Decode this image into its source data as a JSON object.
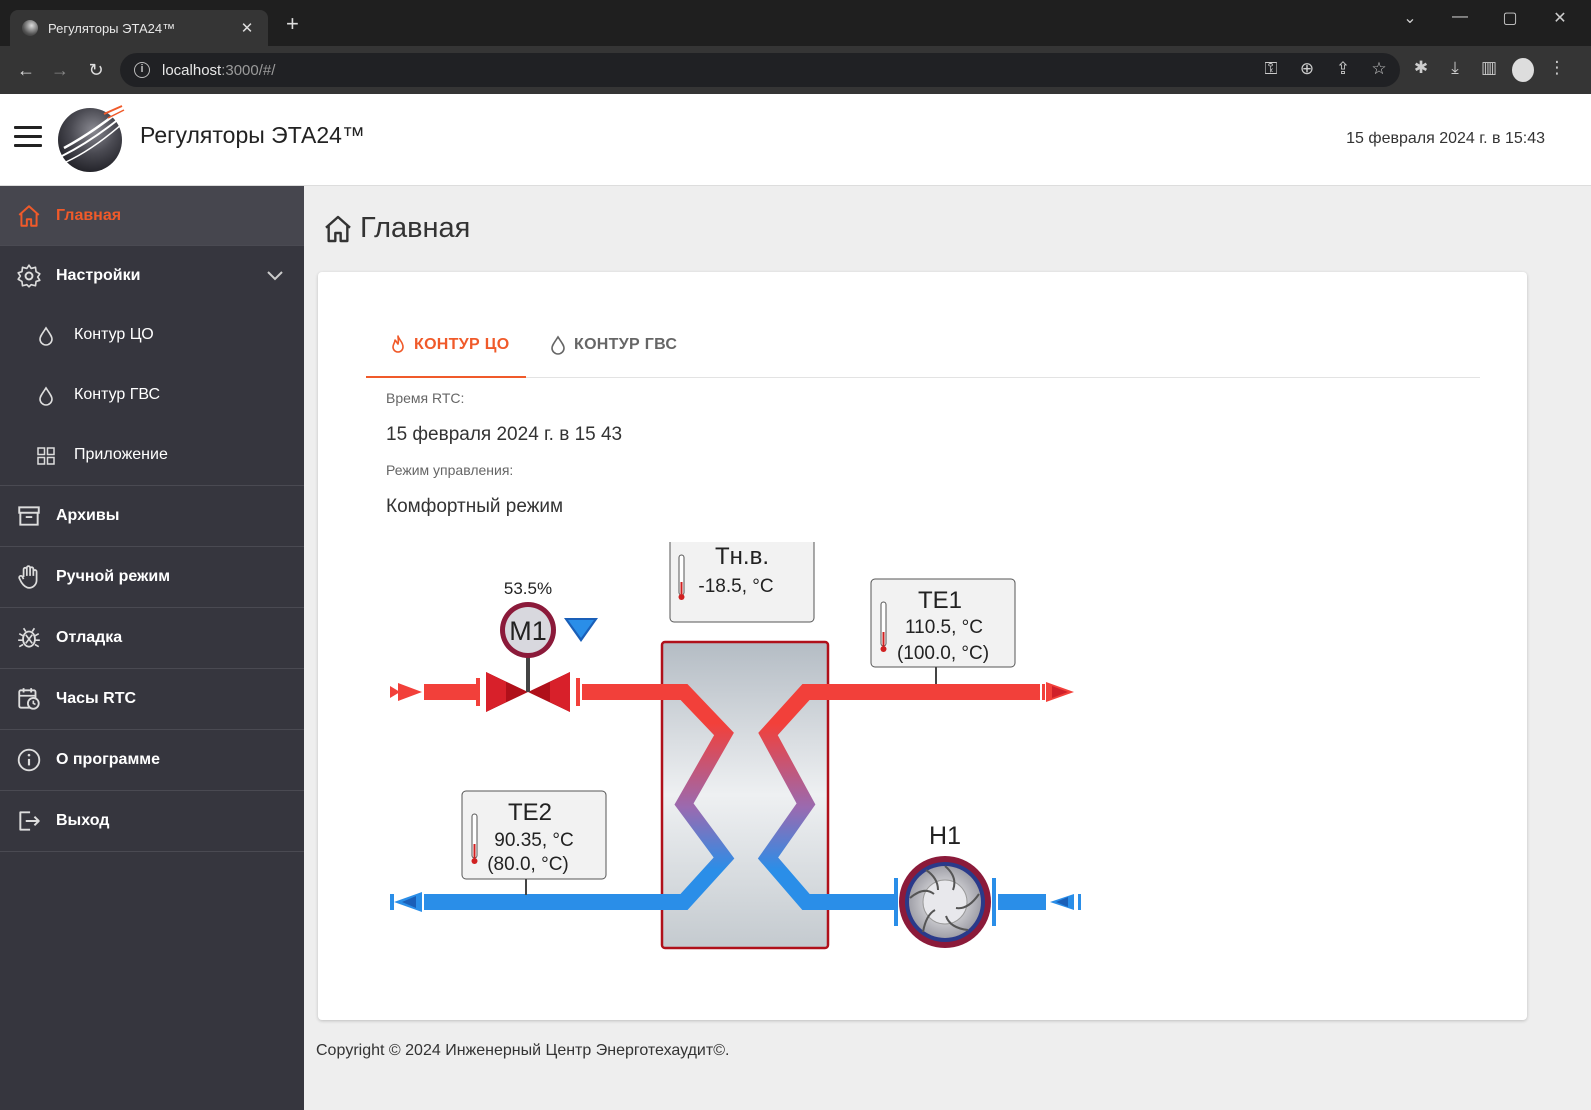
{
  "browser": {
    "tab_title": "Регуляторы ЭТА24™",
    "url_host": "localhost",
    "url_rest": ":3000/#/"
  },
  "header": {
    "title": "Регуляторы ЭТА24™",
    "datetime": "15 февраля 2024 г. в 15:43"
  },
  "sidebar": {
    "items": [
      {
        "label": "Главная",
        "icon": "home-icon"
      },
      {
        "label": "Настройки",
        "icon": "gear-icon"
      },
      {
        "label": "Архивы",
        "icon": "archive-icon"
      },
      {
        "label": "Ручной режим",
        "icon": "hand-icon"
      },
      {
        "label": "Отладка",
        "icon": "bug-icon"
      },
      {
        "label": "Часы RTC",
        "icon": "calendar-clock-icon"
      },
      {
        "label": "О программе",
        "icon": "info-icon"
      },
      {
        "label": "Выход",
        "icon": "logout-icon"
      }
    ],
    "sub_items": [
      {
        "label": "Контур ЦО",
        "icon": "drop-icon"
      },
      {
        "label": "Контур ГВС",
        "icon": "drop-icon"
      },
      {
        "label": "Приложение",
        "icon": "grid-icon"
      }
    ]
  },
  "main": {
    "page_title": "Главная",
    "tabs": [
      {
        "label": "КОНТУР ЦО",
        "icon": "flame-icon",
        "active": true
      },
      {
        "label": "КОНТУР ГВС",
        "icon": "drop-icon",
        "active": false
      }
    ],
    "rtc_label": "Время RTC:",
    "rtc_value": "15 февраля 2024 г. в 15 43",
    "mode_label": "Режим управления:",
    "mode_value": "Комфортный режим"
  },
  "scheme": {
    "valve_percent": "53.5%",
    "valve_name": "M1",
    "outdoor": {
      "name": "Тн.в.",
      "value": "-18.5, °C"
    },
    "te1": {
      "name": "TE1",
      "value": "110.5, °C",
      "setpoint": "(100.0, °C)"
    },
    "te2": {
      "name": "TE2",
      "value": "90.35, °C",
      "setpoint": "(80.0, °C)"
    },
    "pump_name": "H1",
    "colors": {
      "hot": "#f2403a",
      "cold": "#2a8ee8",
      "valve": "#b0101a",
      "frame": "#8b1a3a"
    }
  },
  "footer": {
    "copyright": "Copyright © 2024 Инженерный Центр Энерготехаудит©."
  },
  "colors": {
    "accent": "#f05a2a",
    "sidebar_bg": "#36363e"
  }
}
